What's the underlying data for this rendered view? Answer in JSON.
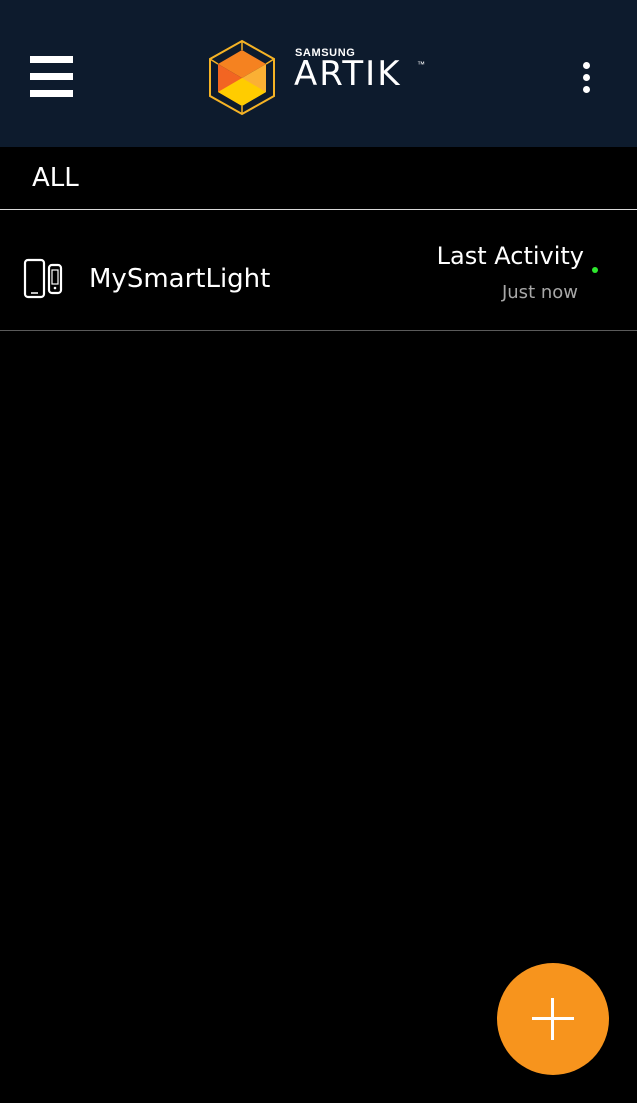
{
  "header": {
    "brand_small": "SAMSUNG",
    "brand_name": "ARTIK",
    "brand_tm": "™",
    "menu_icon": "hamburger-menu-icon",
    "more_icon": "more-vertical-icon",
    "background_color": "#0d1b2d"
  },
  "filter": {
    "label": "ALL"
  },
  "devices": [
    {
      "name": "MySmartLight",
      "icon": "devices-icon",
      "activity_label": "Last Activity",
      "activity_time": "Just now",
      "status_color": "#2ee82e"
    }
  ],
  "fab": {
    "icon": "plus-icon",
    "color": "#f7941d"
  }
}
